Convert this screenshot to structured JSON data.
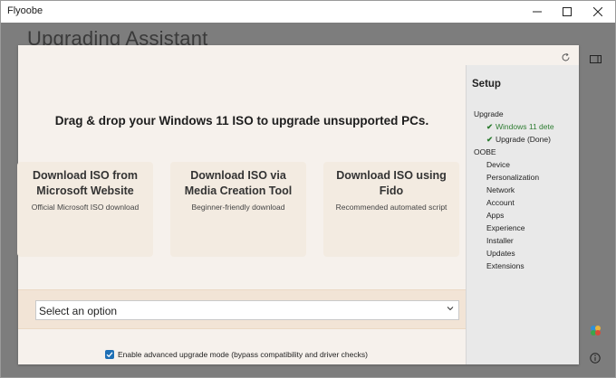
{
  "window": {
    "app_title": "Flyoobe",
    "minimize_icon": "minimize-icon",
    "maximize_icon": "maximize-icon",
    "close_icon": "close-icon",
    "background_heading": "Upgrading Assistant"
  },
  "main": {
    "headline": "Drag & drop your Windows 11 ISO to upgrade unsupported PCs.",
    "refresh_icon": "refresh-icon",
    "cards": [
      {
        "title": "Download ISO from Microsoft Website",
        "subtitle": "Official Microsoft ISO download"
      },
      {
        "title": "Download ISO via Media Creation Tool",
        "subtitle": "Beginner-friendly download"
      },
      {
        "title": "Download ISO using Fido",
        "subtitle": "Recommended automated script"
      }
    ],
    "select": {
      "value": "Select an option"
    },
    "advanced_checkbox": {
      "checked": true,
      "label": "Enable advanced upgrade mode (bypass compatibility and driver checks)"
    }
  },
  "sidebar": {
    "title": "Setup",
    "upgrade_group": "Upgrade",
    "upgrade_items": [
      {
        "label": "Windows 11 dete",
        "done": true
      },
      {
        "label": "Upgrade (Done)",
        "done": true
      }
    ],
    "oobe_group": "OOBE",
    "oobe_items": [
      "Device",
      "Personalization",
      "Network",
      "Account",
      "Apps",
      "Experience",
      "Installer",
      "Updates",
      "Extensions"
    ]
  },
  "colors": {
    "accent": "#1e6fb5",
    "done_green": "#2e7d32",
    "dialog_bg": "#f6f1ec",
    "card_bg": "#f3ebe1",
    "sidebar_bg": "#e9e9e9",
    "overlay": "#7d7d7d"
  }
}
